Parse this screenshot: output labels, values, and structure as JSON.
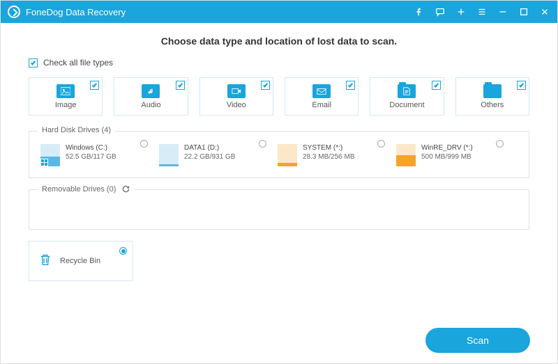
{
  "app": {
    "title": "FoneDog Data Recovery"
  },
  "heading": "Choose data type and location of lost data to scan.",
  "checkAllLabel": "Check all file types",
  "types": [
    {
      "label": "Image"
    },
    {
      "label": "Audio"
    },
    {
      "label": "Video"
    },
    {
      "label": "Email"
    },
    {
      "label": "Document"
    },
    {
      "label": "Others"
    }
  ],
  "hdd": {
    "title": "Hard Disk Drives (4)",
    "drives": [
      {
        "name": "Windows (C:)",
        "size": "52.5 GB/117 GB",
        "color": "blue",
        "win": true,
        "fill": 0.45
      },
      {
        "name": "DATA1 (D:)",
        "size": "22.2 GB/931 GB",
        "color": "blue",
        "win": false,
        "fill": 0.08
      },
      {
        "name": "SYSTEM (*:)",
        "size": "28.3 MB/256 MB",
        "color": "orange",
        "win": false,
        "fill": 0.15
      },
      {
        "name": "WinRE_DRV (*:)",
        "size": "500 MB/999 MB",
        "color": "orange",
        "win": false,
        "fill": 0.5
      }
    ]
  },
  "removable": {
    "title": "Removable Drives (0)"
  },
  "recycle": {
    "label": "Recycle Bin"
  },
  "scanLabel": "Scan"
}
